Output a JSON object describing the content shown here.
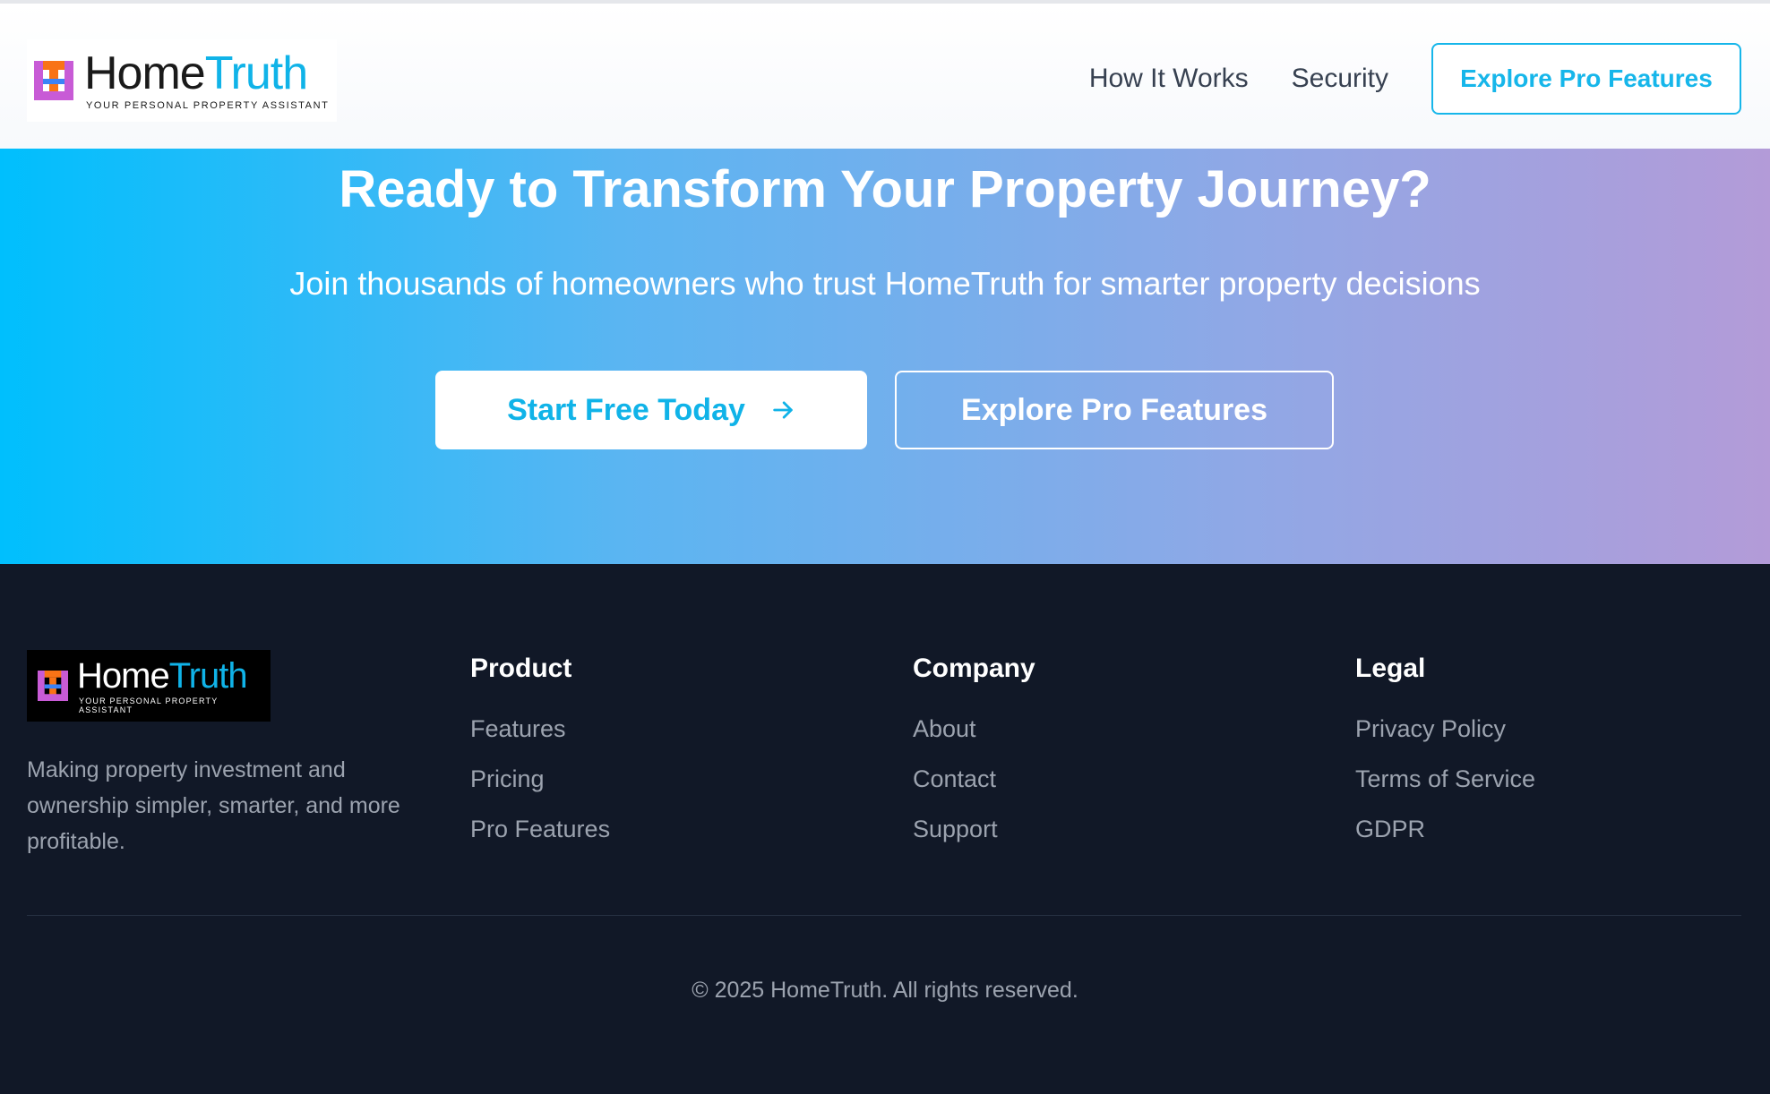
{
  "brand": {
    "name_part1": "Home",
    "name_part2": "Truth",
    "tagline": "YOUR PERSONAL PROPERTY ASSISTANT",
    "accent_color": "#10b3e8"
  },
  "header": {
    "nav": [
      {
        "label": "How It Works"
      },
      {
        "label": "Security"
      }
    ],
    "cta_label": "Explore Pro Features"
  },
  "hero": {
    "title": "Ready to Transform Your Property Journey?",
    "subtitle": "Join thousands of homeowners who trust HomeTruth for smarter property decisions",
    "primary_label": "Start Free Today",
    "primary_icon": "arrow-right-icon",
    "secondary_label": "Explore Pro Features"
  },
  "footer": {
    "description": "Making property investment and ownership simpler, smarter, and more profitable.",
    "columns": [
      {
        "heading": "Product",
        "links": [
          "Features",
          "Pricing",
          "Pro Features"
        ]
      },
      {
        "heading": "Company",
        "links": [
          "About",
          "Contact",
          "Support"
        ]
      },
      {
        "heading": "Legal",
        "links": [
          "Privacy Policy",
          "Terms of Service",
          "GDPR"
        ]
      }
    ],
    "copyright": "© 2025 HomeTruth. All rights reserved."
  }
}
